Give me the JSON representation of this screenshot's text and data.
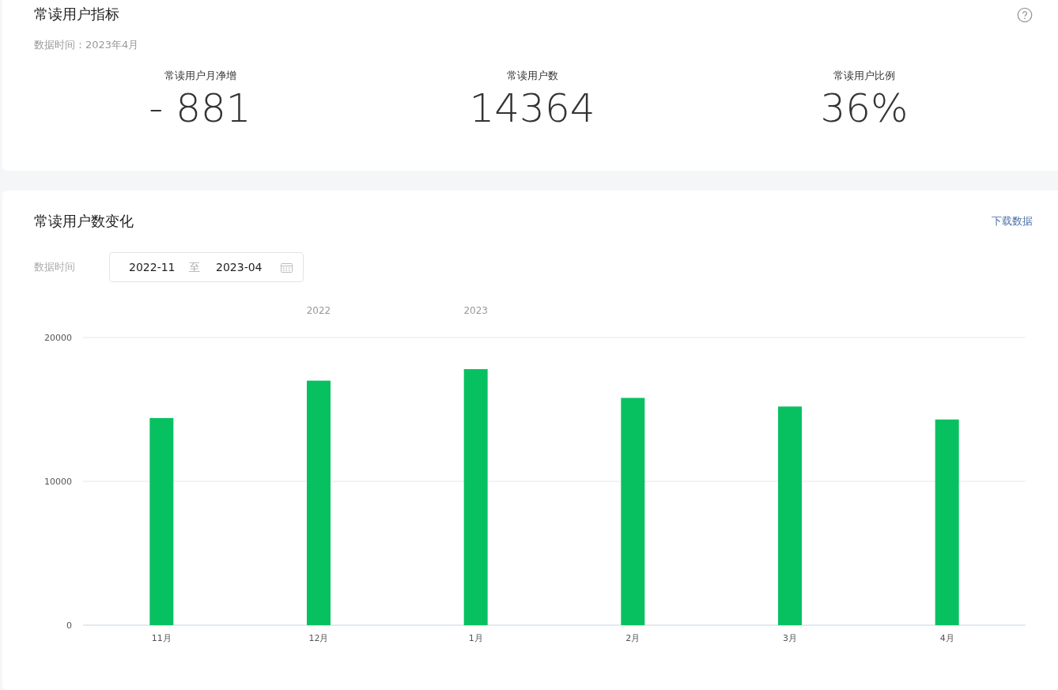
{
  "summary": {
    "title": "常读用户指标",
    "data_time": "数据时间：2023年4月",
    "metrics": [
      {
        "label": "常读用户月净增",
        "value": "- 881"
      },
      {
        "label": "常读用户数",
        "value": "14364"
      },
      {
        "label": "常读用户比例",
        "value": "36%"
      }
    ]
  },
  "trend": {
    "title": "常读用户数变化",
    "download_link": "下载数据",
    "filter_label": "数据时间",
    "date_range": {
      "start": "2022-11",
      "separator": "至",
      "end": "2023-04"
    },
    "chart_data": {
      "type": "bar",
      "categories": [
        "11月",
        "12月",
        "1月",
        "2月",
        "3月",
        "4月"
      ],
      "series": [
        {
          "color": "#07c160",
          "values": [
            14400,
            17000,
            17800,
            15800,
            15200,
            14300
          ]
        }
      ],
      "ylim": [
        0,
        20000
      ],
      "yticks": [
        0,
        10000,
        20000
      ]
    },
    "year_labels": [
      "2022",
      "2023"
    ]
  }
}
